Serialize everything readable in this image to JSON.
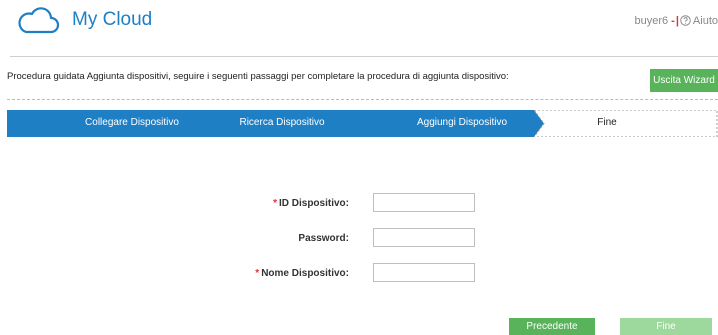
{
  "header": {
    "title": "My Cloud",
    "logo_icon": "cloud-icon",
    "username": "buyer6",
    "help_label": "Aiuto",
    "help_icon": "help-circle-icon"
  },
  "wizard": {
    "instruction": "Procedura guidata Aggiunta dispositivi, seguire i seguenti passaggi per completare la procedura di aggiunta dispositivo:",
    "exit_label": "Uscita Wizard",
    "steps": [
      {
        "label": "Collegare Dispositivo",
        "state": "done"
      },
      {
        "label": "Ricerca Dispositivo",
        "state": "done"
      },
      {
        "label": "Aggiungi Dispositivo",
        "state": "current"
      },
      {
        "label": "Fine",
        "state": "pending"
      }
    ],
    "step_color": "#1e7fc4"
  },
  "form": {
    "fields": [
      {
        "label": "ID Dispositivo:",
        "required": true,
        "value": ""
      },
      {
        "label": "Password:",
        "required": false,
        "value": ""
      },
      {
        "label": "Nome Dispositivo:",
        "required": true,
        "value": ""
      }
    ],
    "required_mark": "*"
  },
  "footer": {
    "prev_label": "Precedente",
    "finish_label": "Fine"
  }
}
